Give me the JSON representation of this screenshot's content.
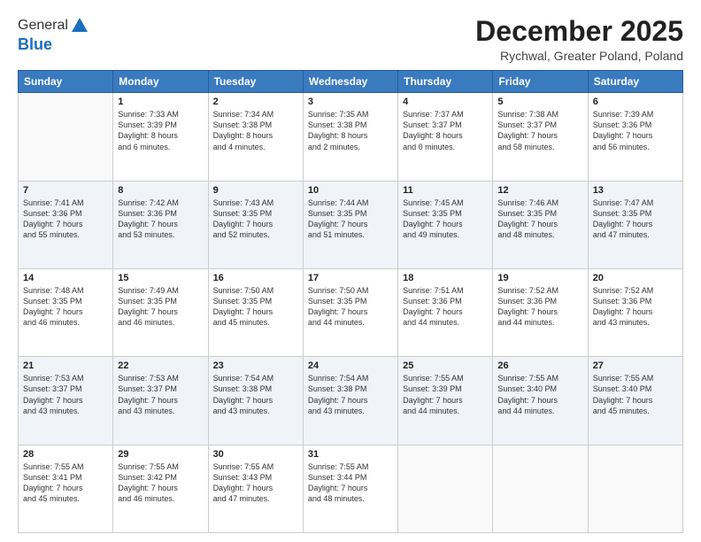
{
  "logo": {
    "line1": "General",
    "line2": "Blue"
  },
  "title": "December 2025",
  "subtitle": "Rychwal, Greater Poland, Poland",
  "days_header": [
    "Sunday",
    "Monday",
    "Tuesday",
    "Wednesday",
    "Thursday",
    "Friday",
    "Saturday"
  ],
  "weeks": [
    [
      {
        "day": "",
        "content": ""
      },
      {
        "day": "1",
        "content": "Sunrise: 7:33 AM\nSunset: 3:39 PM\nDaylight: 8 hours\nand 6 minutes."
      },
      {
        "day": "2",
        "content": "Sunrise: 7:34 AM\nSunset: 3:38 PM\nDaylight: 8 hours\nand 4 minutes."
      },
      {
        "day": "3",
        "content": "Sunrise: 7:35 AM\nSunset: 3:38 PM\nDaylight: 8 hours\nand 2 minutes."
      },
      {
        "day": "4",
        "content": "Sunrise: 7:37 AM\nSunset: 3:37 PM\nDaylight: 8 hours\nand 0 minutes."
      },
      {
        "day": "5",
        "content": "Sunrise: 7:38 AM\nSunset: 3:37 PM\nDaylight: 7 hours\nand 58 minutes."
      },
      {
        "day": "6",
        "content": "Sunrise: 7:39 AM\nSunset: 3:36 PM\nDaylight: 7 hours\nand 56 minutes."
      }
    ],
    [
      {
        "day": "7",
        "content": "Sunrise: 7:41 AM\nSunset: 3:36 PM\nDaylight: 7 hours\nand 55 minutes."
      },
      {
        "day": "8",
        "content": "Sunrise: 7:42 AM\nSunset: 3:36 PM\nDaylight: 7 hours\nand 53 minutes."
      },
      {
        "day": "9",
        "content": "Sunrise: 7:43 AM\nSunset: 3:35 PM\nDaylight: 7 hours\nand 52 minutes."
      },
      {
        "day": "10",
        "content": "Sunrise: 7:44 AM\nSunset: 3:35 PM\nDaylight: 7 hours\nand 51 minutes."
      },
      {
        "day": "11",
        "content": "Sunrise: 7:45 AM\nSunset: 3:35 PM\nDaylight: 7 hours\nand 49 minutes."
      },
      {
        "day": "12",
        "content": "Sunrise: 7:46 AM\nSunset: 3:35 PM\nDaylight: 7 hours\nand 48 minutes."
      },
      {
        "day": "13",
        "content": "Sunrise: 7:47 AM\nSunset: 3:35 PM\nDaylight: 7 hours\nand 47 minutes."
      }
    ],
    [
      {
        "day": "14",
        "content": "Sunrise: 7:48 AM\nSunset: 3:35 PM\nDaylight: 7 hours\nand 46 minutes."
      },
      {
        "day": "15",
        "content": "Sunrise: 7:49 AM\nSunset: 3:35 PM\nDaylight: 7 hours\nand 46 minutes."
      },
      {
        "day": "16",
        "content": "Sunrise: 7:50 AM\nSunset: 3:35 PM\nDaylight: 7 hours\nand 45 minutes."
      },
      {
        "day": "17",
        "content": "Sunrise: 7:50 AM\nSunset: 3:35 PM\nDaylight: 7 hours\nand 44 minutes."
      },
      {
        "day": "18",
        "content": "Sunrise: 7:51 AM\nSunset: 3:36 PM\nDaylight: 7 hours\nand 44 minutes."
      },
      {
        "day": "19",
        "content": "Sunrise: 7:52 AM\nSunset: 3:36 PM\nDaylight: 7 hours\nand 44 minutes."
      },
      {
        "day": "20",
        "content": "Sunrise: 7:52 AM\nSunset: 3:36 PM\nDaylight: 7 hours\nand 43 minutes."
      }
    ],
    [
      {
        "day": "21",
        "content": "Sunrise: 7:53 AM\nSunset: 3:37 PM\nDaylight: 7 hours\nand 43 minutes."
      },
      {
        "day": "22",
        "content": "Sunrise: 7:53 AM\nSunset: 3:37 PM\nDaylight: 7 hours\nand 43 minutes."
      },
      {
        "day": "23",
        "content": "Sunrise: 7:54 AM\nSunset: 3:38 PM\nDaylight: 7 hours\nand 43 minutes."
      },
      {
        "day": "24",
        "content": "Sunrise: 7:54 AM\nSunset: 3:38 PM\nDaylight: 7 hours\nand 43 minutes."
      },
      {
        "day": "25",
        "content": "Sunrise: 7:55 AM\nSunset: 3:39 PM\nDaylight: 7 hours\nand 44 minutes."
      },
      {
        "day": "26",
        "content": "Sunrise: 7:55 AM\nSunset: 3:40 PM\nDaylight: 7 hours\nand 44 minutes."
      },
      {
        "day": "27",
        "content": "Sunrise: 7:55 AM\nSunset: 3:40 PM\nDaylight: 7 hours\nand 45 minutes."
      }
    ],
    [
      {
        "day": "28",
        "content": "Sunrise: 7:55 AM\nSunset: 3:41 PM\nDaylight: 7 hours\nand 45 minutes."
      },
      {
        "day": "29",
        "content": "Sunrise: 7:55 AM\nSunset: 3:42 PM\nDaylight: 7 hours\nand 46 minutes."
      },
      {
        "day": "30",
        "content": "Sunrise: 7:55 AM\nSunset: 3:43 PM\nDaylight: 7 hours\nand 47 minutes."
      },
      {
        "day": "31",
        "content": "Sunrise: 7:55 AM\nSunset: 3:44 PM\nDaylight: 7 hours\nand 48 minutes."
      },
      {
        "day": "",
        "content": ""
      },
      {
        "day": "",
        "content": ""
      },
      {
        "day": "",
        "content": ""
      }
    ]
  ]
}
